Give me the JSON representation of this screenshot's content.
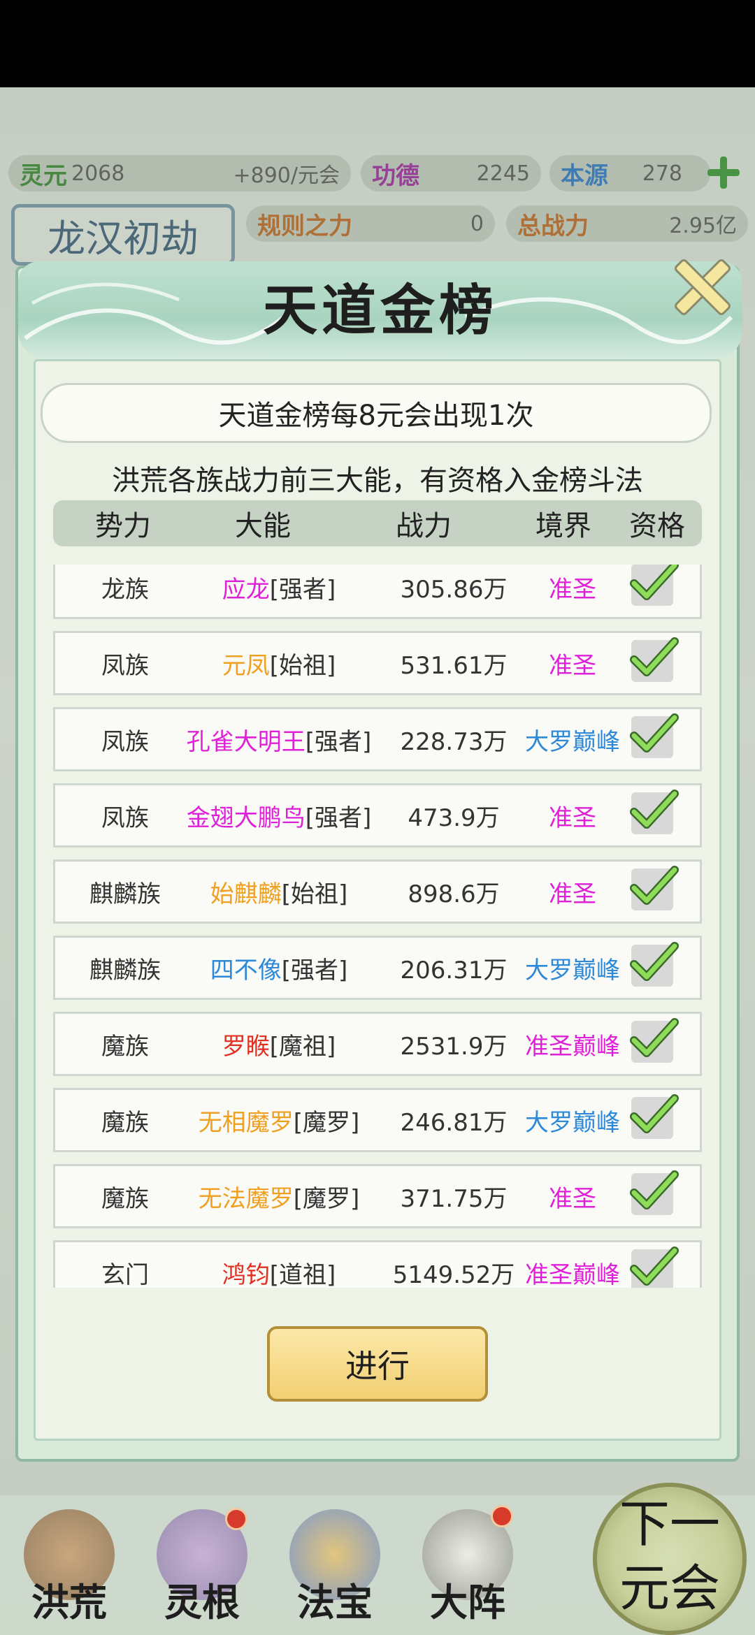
{
  "resources": {
    "lingyuan_label": "灵元",
    "lingyuan_value": "2068",
    "lingyuan_rate": "+890/元会",
    "gongde_label": "功德",
    "gongde_value": "2245",
    "benyuan_label": "本源",
    "benyuan_value": "278",
    "rule_label": "规则之力",
    "rule_value": "0",
    "total_power_label": "总战力",
    "total_power_value": "2.95亿"
  },
  "stage_title": "龙汉初劫",
  "modal": {
    "title": "天道金榜",
    "banner": "天道金榜每8元会出现1次",
    "subtitle": "洪荒各族战力前三大能，有资格入金榜斗法",
    "headers": {
      "faction": "势力",
      "name": "大能",
      "power": "战力",
      "realm": "境界",
      "qualification": "资格"
    },
    "rows": [
      {
        "faction": "龙族",
        "name": "应龙",
        "title": "[强者]",
        "power": "305.86万",
        "realm": "准圣",
        "name_color": "#e020d8",
        "realm_color": "#e020d8"
      },
      {
        "faction": "凤族",
        "name": "元凤",
        "title": "[始祖]",
        "power": "531.61万",
        "realm": "准圣",
        "name_color": "#f0a020",
        "realm_color": "#e020d8"
      },
      {
        "faction": "凤族",
        "name": "孔雀大明王",
        "title": "[强者]",
        "power": "228.73万",
        "realm": "大罗巅峰",
        "name_color": "#e020d8",
        "realm_color": "#2e8ad8"
      },
      {
        "faction": "凤族",
        "name": "金翅大鹏鸟",
        "title": "[强者]",
        "power": "473.9万",
        "realm": "准圣",
        "name_color": "#e020d8",
        "realm_color": "#e020d8"
      },
      {
        "faction": "麒麟族",
        "name": "始麒麟",
        "title": "[始祖]",
        "power": "898.6万",
        "realm": "准圣",
        "name_color": "#f0a020",
        "realm_color": "#e020d8"
      },
      {
        "faction": "麒麟族",
        "name": "四不像",
        "title": "[强者]",
        "power": "206.31万",
        "realm": "大罗巅峰",
        "name_color": "#2e8ad8",
        "realm_color": "#2e8ad8"
      },
      {
        "faction": "魔族",
        "name": "罗睺",
        "title": "[魔祖]",
        "power": "2531.9万",
        "realm": "准圣巅峰",
        "name_color": "#e03020",
        "realm_color": "#e020d8"
      },
      {
        "faction": "魔族",
        "name": "无相魔罗",
        "title": "[魔罗]",
        "power": "246.81万",
        "realm": "大罗巅峰",
        "name_color": "#f0a020",
        "realm_color": "#2e8ad8"
      },
      {
        "faction": "魔族",
        "name": "无法魔罗",
        "title": "[魔罗]",
        "power": "371.75万",
        "realm": "准圣",
        "name_color": "#f0a020",
        "realm_color": "#e020d8"
      },
      {
        "faction": "玄门",
        "name": "鸿钧",
        "title": "[道祖]",
        "power": "5149.52万",
        "realm": "准圣巅峰",
        "name_color": "#e03020",
        "realm_color": "#e020d8"
      }
    ],
    "proceed_label": "进行"
  },
  "bottom_nav": {
    "items": [
      "洪荒",
      "灵根",
      "法宝",
      "大阵"
    ],
    "next_era_line1": "下一",
    "next_era_line2": "元会"
  }
}
